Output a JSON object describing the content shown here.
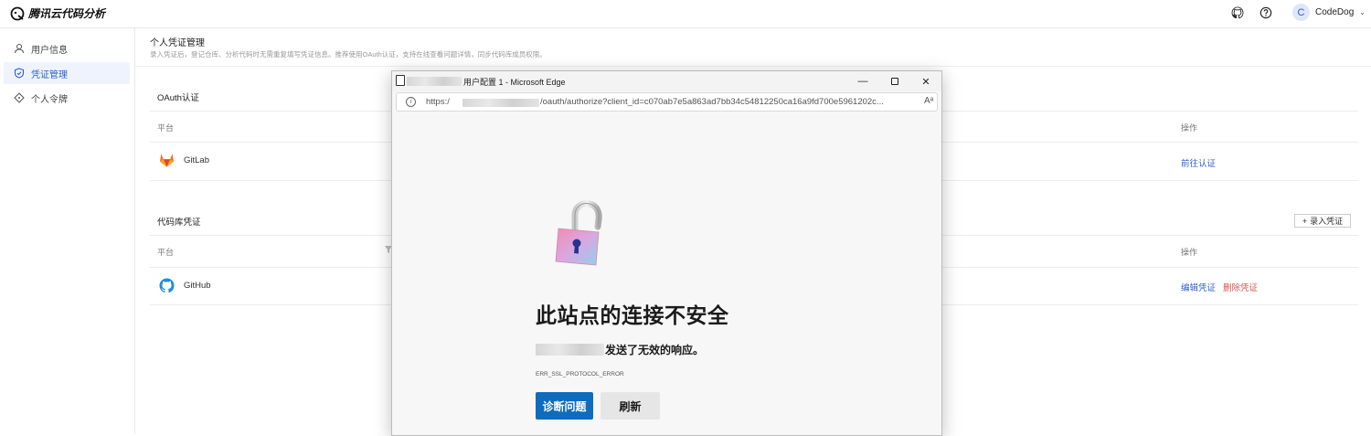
{
  "app": {
    "brand": "腾讯云代码分析",
    "user_initial": "C",
    "user_name": "CodeDog"
  },
  "sidebar": {
    "items": [
      {
        "label": "用户信息",
        "icon": "user-icon"
      },
      {
        "label": "凭证管理",
        "icon": "shield-icon",
        "active": true
      },
      {
        "label": "个人令牌",
        "icon": "diamond-icon"
      }
    ]
  },
  "page": {
    "title": "个人凭证管理",
    "desc": "录入凭证后，登记仓库、分析代码时无需重复填写凭证信息。推荐使用OAuth认证，支持在线查看问题详情，同步代码库成员权限。"
  },
  "oauth": {
    "title": "OAuth认证",
    "col_platform": "平台",
    "col_action": "操作",
    "rows": [
      {
        "platform": "GitLab",
        "action": "前往认证"
      }
    ]
  },
  "repo": {
    "title": "代码库凭证",
    "add_label": "录入凭证",
    "col_platform": "平台",
    "col_action": "操作",
    "rows": [
      {
        "platform": "GitHub",
        "edit": "编辑凭证",
        "delete": "删除凭证"
      }
    ]
  },
  "popup": {
    "title": "用户配置 1 - Microsoft Edge",
    "url_prefix": "https:/",
    "url_path": "/oauth/authorize?client_id=c070ab7e5a863ad7bb34c54812250ca16a9fd700e5961202c...",
    "error_title": "此站点的连接不安全",
    "error_desc": "发送了无效的响应。",
    "error_code": "ERR_SSL_PROTOCOL_ERROR",
    "btn_diagnose": "诊断问题",
    "btn_refresh": "刷新"
  },
  "colors": {
    "accent": "#2f5fd0",
    "danger": "#e34d4d",
    "edge_button": "#0f6cbd"
  }
}
